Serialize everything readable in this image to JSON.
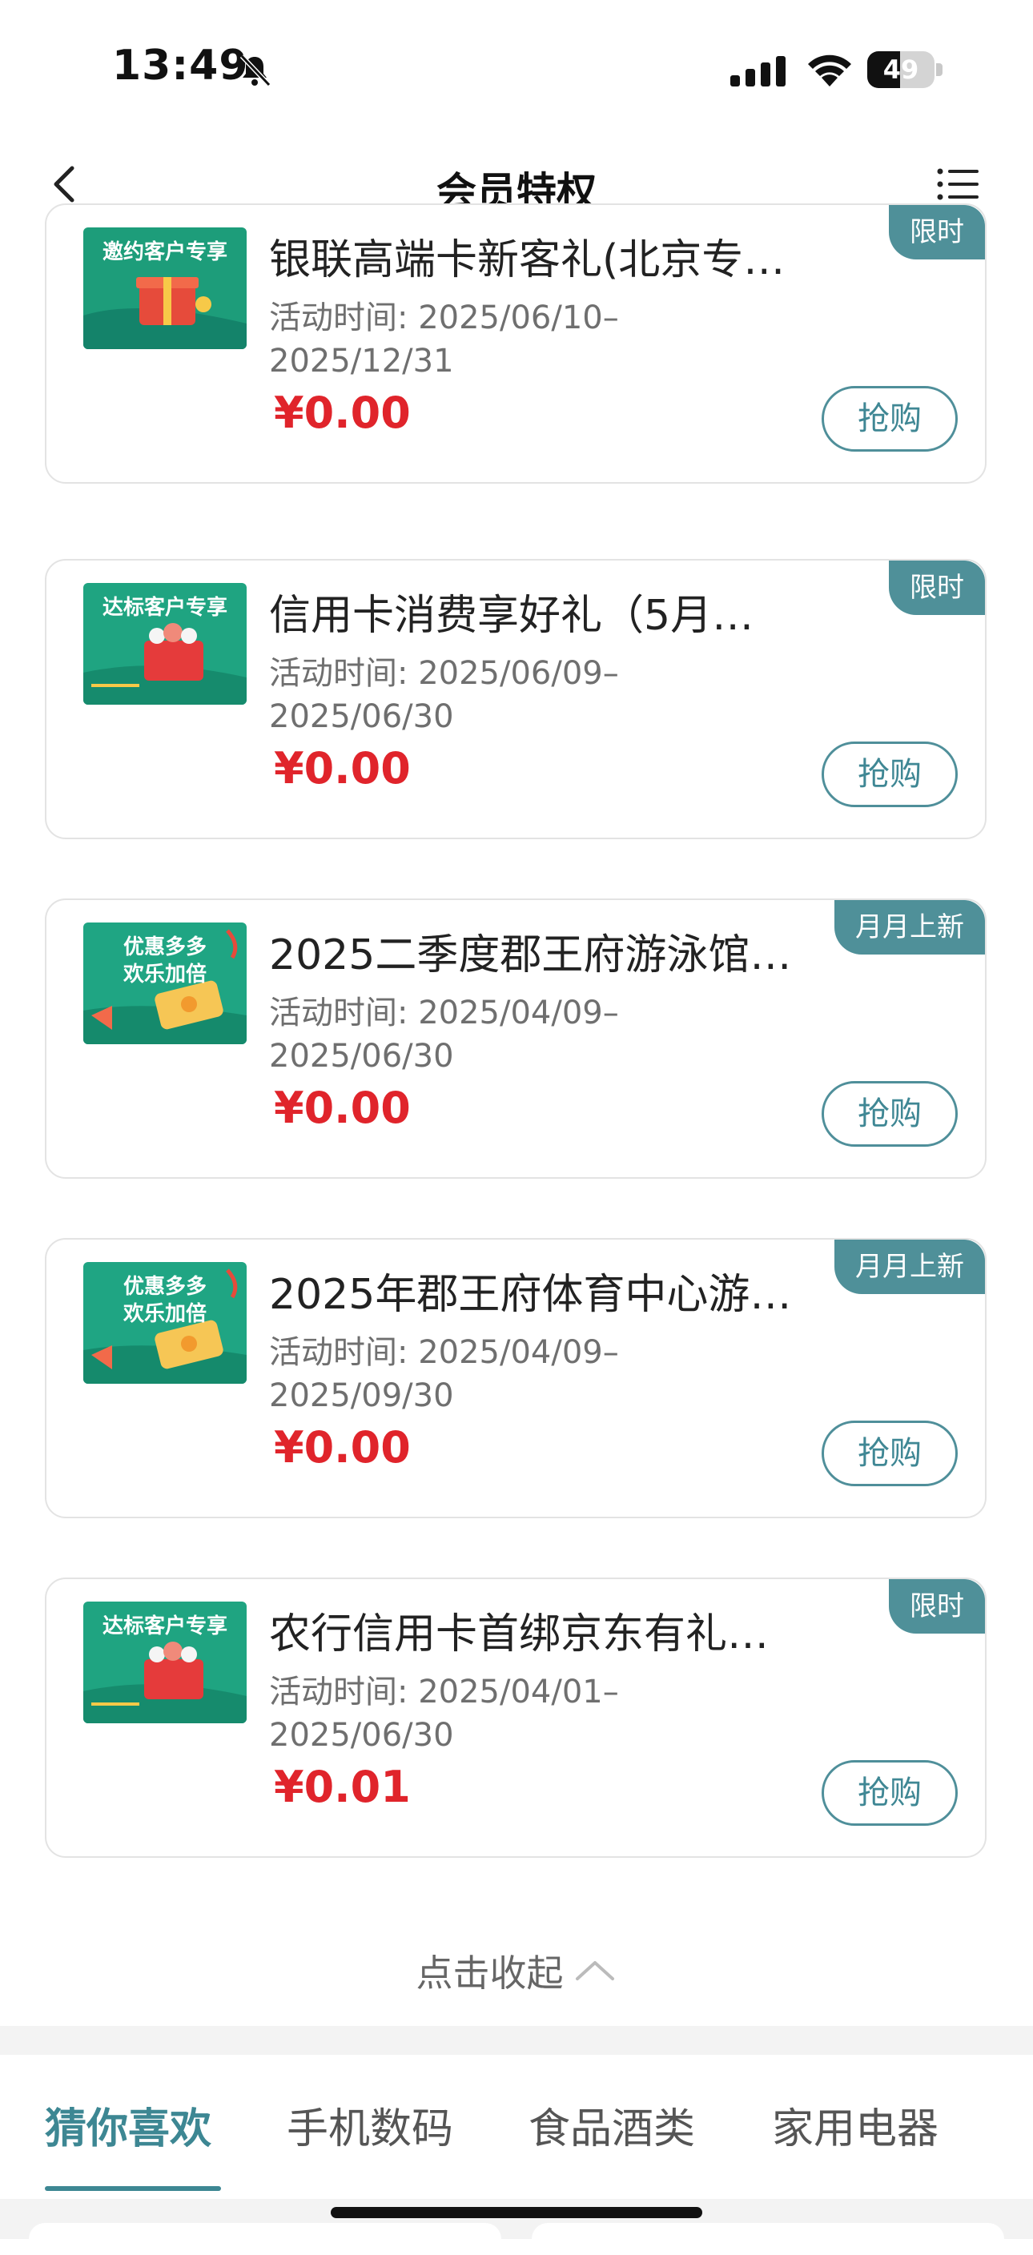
{
  "status_bar": {
    "time": "13:49",
    "battery": "49",
    "battery_level": 0.49,
    "icons": [
      "bell-slash-icon",
      "signal-icon",
      "wifi-icon",
      "battery-icon"
    ]
  },
  "nav": {
    "title": "会员特权",
    "back_icon": "chevron-left-icon",
    "menu_icon": "list-menu-icon"
  },
  "cards": [
    {
      "thumb_text": "邀约客户专享",
      "title": "银联高端卡新客礼(北京专…",
      "date": "活动时间: 2025/06/10–2025/12/31",
      "price": "¥0.00",
      "button": "抢购",
      "tag": "限时"
    },
    {
      "thumb_text": "达标客户专享",
      "title": "信用卡消费享好礼（5月…",
      "date": "活动时间: 2025/06/09–2025/06/30",
      "price": "¥0.00",
      "button": "抢购",
      "tag": "限时"
    },
    {
      "thumb_text": "优惠多多\n欢乐加倍",
      "title": "2025二季度郡王府游泳馆…",
      "date": "活动时间: 2025/04/09–2025/06/30",
      "price": "¥0.00",
      "button": "抢购",
      "tag": "月月上新"
    },
    {
      "thumb_text": "优惠多多\n欢乐加倍",
      "title": "2025年郡王府体育中心游…",
      "date": "活动时间: 2025/04/09–2025/09/30",
      "price": "¥0.00",
      "button": "抢购",
      "tag": "月月上新"
    },
    {
      "thumb_text": "达标客户专享",
      "title": "农行信用卡首绑京东有礼…",
      "date": "活动时间: 2025/04/01–2025/06/30",
      "price": "¥0.01",
      "button": "抢购",
      "tag": "限时"
    }
  ],
  "collapse": {
    "label": "点击收起",
    "icon": "chevron-up-icon"
  },
  "tabs": [
    {
      "label": "猜你喜欢",
      "active": true
    },
    {
      "label": "手机数码",
      "active": false
    },
    {
      "label": "食品酒类",
      "active": false
    },
    {
      "label": "家用电器",
      "active": false
    }
  ],
  "colors": {
    "accent": "#3d8793",
    "tag_bg": "#4f9099",
    "price": "#e0242b",
    "thumb_green": "#1d9d7a"
  }
}
